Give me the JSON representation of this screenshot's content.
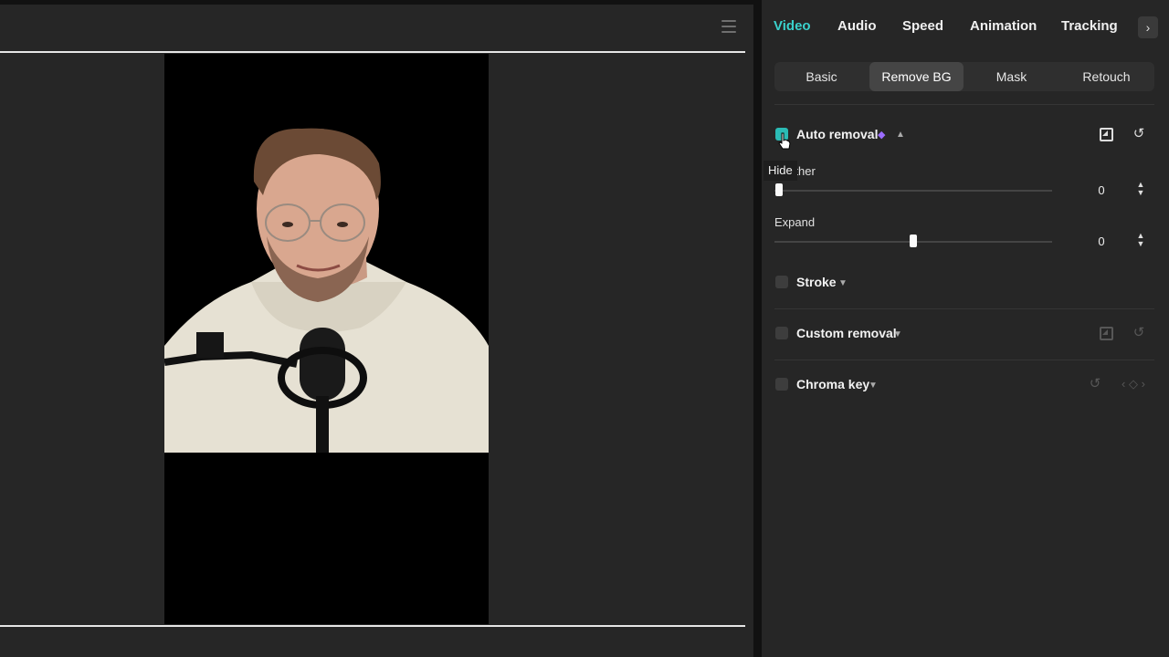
{
  "preview": {
    "menu_icon": "hamburger-menu-icon"
  },
  "inspector": {
    "tabs": [
      {
        "label": "Video",
        "active": true
      },
      {
        "label": "Audio",
        "active": false
      },
      {
        "label": "Speed",
        "active": false
      },
      {
        "label": "Animation",
        "active": false
      },
      {
        "label": "Tracking",
        "active": false
      }
    ],
    "tabs_next_icon": "chevron-right-icon",
    "subtabs": [
      {
        "label": "Basic",
        "active": false
      },
      {
        "label": "Remove BG",
        "active": true
      },
      {
        "label": "Mask",
        "active": false
      },
      {
        "label": "Retouch",
        "active": false
      }
    ],
    "auto_removal": {
      "label": "Auto removal",
      "checked": true,
      "pro_badge_icon": "diamond-icon",
      "feather_label": "Feather",
      "feather_value": "0",
      "expand_label": "Expand",
      "expand_value": "0"
    },
    "stroke": {
      "label": "Stroke",
      "checked": false
    },
    "custom_removal": {
      "label": "Custom removal",
      "checked": false
    },
    "chroma_key": {
      "label": "Chroma key",
      "checked": false
    },
    "tooltip": "Hide",
    "accent_color": "#3ad1cc"
  }
}
